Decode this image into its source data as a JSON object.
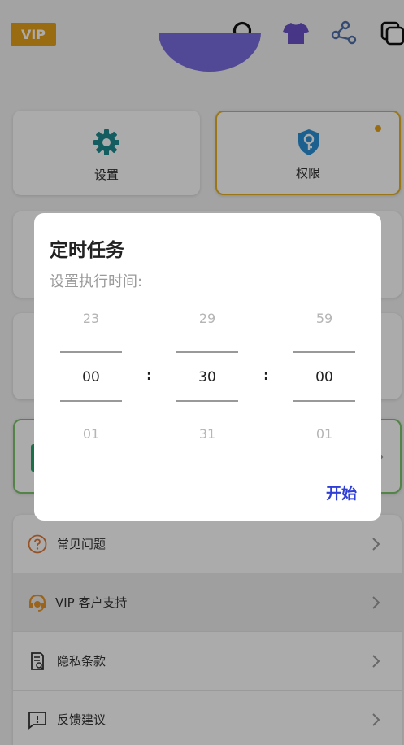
{
  "topbar": {
    "vip_badge": "VIP"
  },
  "cards": {
    "settings_label": "设置",
    "permissions_label": "权限"
  },
  "menu": {
    "items": [
      {
        "label": "常见问题",
        "icon": "question-circle-icon"
      },
      {
        "label": "VIP 客户支持",
        "icon": "headset-icon"
      },
      {
        "label": "隐私条款",
        "icon": "document-search-icon"
      },
      {
        "label": "反馈建议",
        "icon": "feedback-icon"
      }
    ]
  },
  "dialog": {
    "title": "定时任务",
    "subtitle": "设置执行时间:",
    "hours": {
      "prev": "23",
      "current": "00",
      "next": "01"
    },
    "minutes": {
      "prev": "29",
      "current": "30",
      "next": "31"
    },
    "seconds": {
      "prev": "59",
      "current": "00",
      "next": "01"
    },
    "separator": ":",
    "start_button": "开始"
  },
  "colors": {
    "accent_blue": "#2f3fd6",
    "vip_gold": "#e6a21a",
    "teal": "#1d8a8f",
    "highlight_border": "#e6b022",
    "green_border": "#7ec36a"
  }
}
